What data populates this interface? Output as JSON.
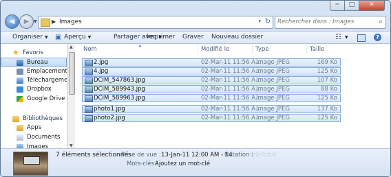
{
  "window": {
    "min_glyph": "─",
    "max_glyph": "□",
    "close_glyph": "✕"
  },
  "address": {
    "crumb": "Images",
    "chevron": "▶",
    "dropdown": "▾",
    "refresh": "↻"
  },
  "search": {
    "placeholder": "Rechercher dans : Images",
    "icon": "search-icon"
  },
  "toolbar": {
    "organize": "Organiser",
    "preview": "Aperçu",
    "share": "Partager avec",
    "print": "Imprimer",
    "burn": "Graver",
    "new_folder": "Nouveau dossier"
  },
  "nav": {
    "favorites": "Favoris",
    "desktop": "Bureau",
    "recent": "Emplacements ré",
    "downloads": "Téléchargement",
    "dropbox": "Dropbox",
    "gdrive": "Google Drive",
    "libraries": "Bibliothèques",
    "apps": "Apps",
    "documents": "Documents",
    "images": "Images"
  },
  "columns": {
    "name": "Nom",
    "date": "Modifié le",
    "type": "Type",
    "size": "Taille"
  },
  "files": [
    {
      "name": "2.jpg",
      "date": "02-Mar-11 11:56 A...",
      "type": "Image JPEG",
      "size": "169 Ko"
    },
    {
      "name": "4.jpg",
      "date": "02-Mar-11 11:56 A...",
      "type": "Image JPEG",
      "size": "125 Ko"
    },
    {
      "name": "DCIM_547863.jpg",
      "date": "02-Mar-11 11:56 A...",
      "type": "Image JPEG",
      "size": "107 Ko"
    },
    {
      "name": "DCIM_589943.jpg",
      "date": "02-Mar-11 11:56 A...",
      "type": "Image JPEG",
      "size": "88 Ko"
    },
    {
      "name": "DCIM_589963.jpg",
      "date": "02-Mar-11 11:56 A...",
      "type": "Image JPEG",
      "size": "125 Ko"
    },
    {
      "name": "photo1.jpg",
      "date": "02-Mar-11 11:56 A...",
      "type": "Image JPEG",
      "size": "137 Ko"
    },
    {
      "name": "photo2.jpg",
      "date": "02-Mar-11 11:56 A...",
      "type": "Image JPEG",
      "size": "125 Ko"
    }
  ],
  "details": {
    "count": "7 éléments sélectionnés",
    "date_label": "Prise de vue :",
    "date_value": "13-Jan-11 12:00 AM - 14...",
    "rating_label": "Notation :",
    "rating_stars": "☆☆☆☆☆",
    "tags_label": "Mots-clés :",
    "tags_value": "Ajoutez un mot-clé"
  },
  "colors": {
    "accent": "#3d76c0",
    "selection": "#cde3fb",
    "chrome": "#d6e4f3"
  }
}
